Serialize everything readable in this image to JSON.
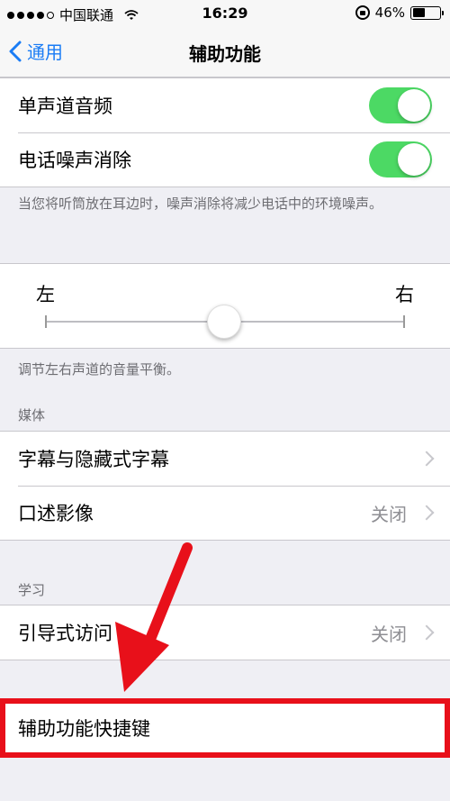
{
  "status": {
    "carrier": "中国联通",
    "time": "16:29",
    "battery": "46%",
    "battery_level": 0.46
  },
  "nav": {
    "back_label": "通用",
    "title": "辅助功能"
  },
  "hearing": {
    "mono_audio": {
      "label": "单声道音频",
      "on": true
    },
    "noise_cancel": {
      "label": "电话噪声消除",
      "on": true
    },
    "footer": "当您将听筒放在耳边时，噪声消除将减少电话中的环境噪声。"
  },
  "balance": {
    "left": "左",
    "right": "右",
    "level": 0.5,
    "footer": "调节左右声道的音量平衡。"
  },
  "media": {
    "header": "媒体",
    "items": [
      {
        "label": "字幕与隐藏式字幕",
        "value": ""
      },
      {
        "label": "口述影像",
        "value": "关闭"
      }
    ]
  },
  "learning": {
    "header": "学习",
    "items": [
      {
        "label": "引导式访问",
        "value": "关闭"
      }
    ]
  },
  "shortcut": {
    "label": "辅助功能快捷键"
  },
  "colors": {
    "accent": "#1a7cf5",
    "toggle_on": "#4cd964",
    "annotation": "#e8101a"
  }
}
